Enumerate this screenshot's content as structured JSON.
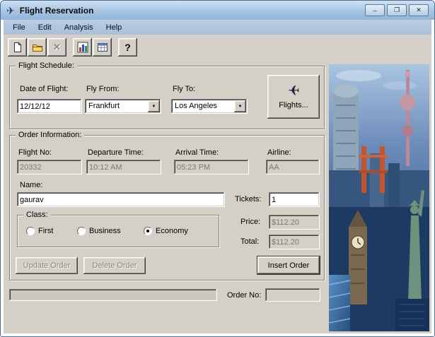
{
  "window": {
    "title": "Flight Reservation",
    "minimize_glyph": "–",
    "maximize_glyph": "❐",
    "close_glyph": "✕"
  },
  "menu": {
    "file": "File",
    "edit": "Edit",
    "analysis": "Analysis",
    "help": "Help"
  },
  "toolbar": {
    "delete_glyph": "✕",
    "help_glyph": "?"
  },
  "flight_schedule": {
    "group_label": "Flight Schedule:",
    "date_of_flight_label": "Date of Flight:",
    "date_of_flight_value": "12/12/12",
    "fly_from_label": "Fly From:",
    "fly_from_value": "Frankfurt",
    "fly_to_label": "Fly To:",
    "fly_to_value": "Los Angeles",
    "flights_button_label": "Flights..."
  },
  "order_info": {
    "group_label": "Order Information:",
    "flight_no_label": "Flight No:",
    "flight_no_value": "20332",
    "departure_time_label": "Departure Time:",
    "departure_time_value": "10:12 AM",
    "arrival_time_label": "Arrival Time:",
    "arrival_time_value": "05:23 PM",
    "airline_label": "Airline:",
    "airline_value": "AA",
    "name_label": "Name:",
    "name_value": "gaurav",
    "tickets_label": "Tickets:",
    "tickets_value": "1",
    "class_group_label": "Class:",
    "class_options": [
      {
        "label": "First",
        "selected": false
      },
      {
        "label": "Business",
        "selected": false
      },
      {
        "label": "Economy",
        "selected": true
      }
    ],
    "price_label": "Price:",
    "price_value": "$112.20",
    "total_label": "Total:",
    "total_value": "$112.20",
    "update_order_label": "Update Order",
    "delete_order_label": "Delete Order",
    "insert_order_label": "Insert Order"
  },
  "status": {
    "order_no_label": "Order No:",
    "order_no_value": ""
  }
}
